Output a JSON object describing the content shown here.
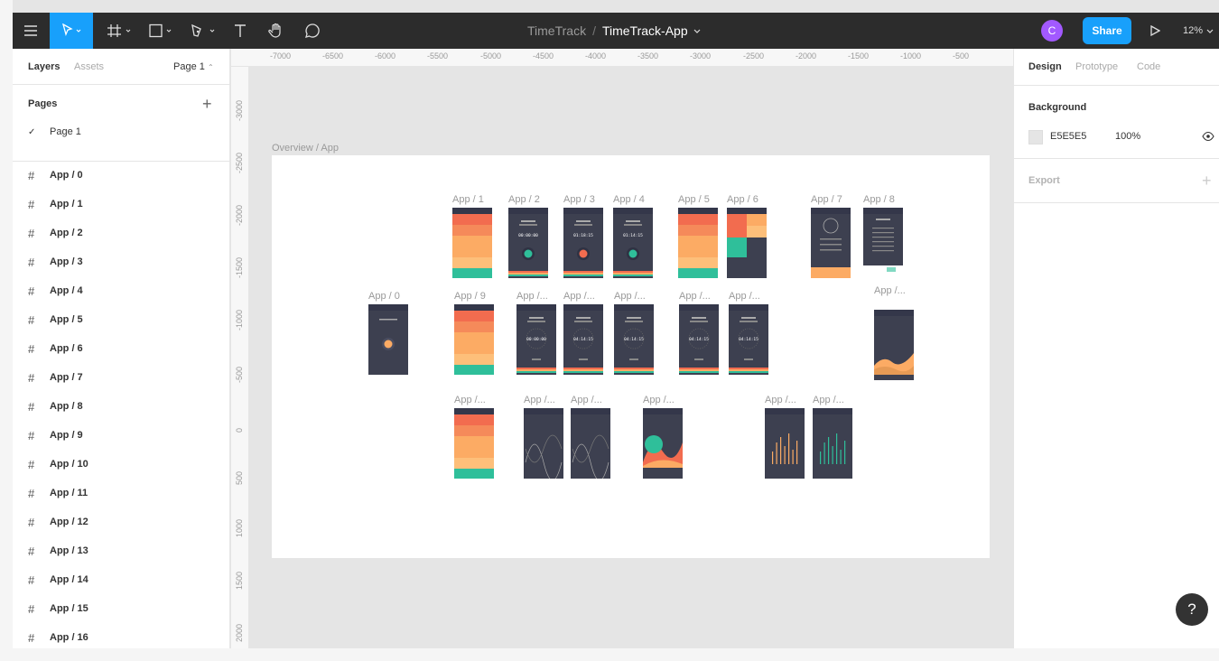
{
  "toolbar": {
    "project": "TimeTrack",
    "separator": "/",
    "file": "TimeTrack-App",
    "avatar_initial": "C",
    "share_label": "Share",
    "zoom": "12%",
    "tools": [
      "menu-icon",
      "move-icon",
      "frame-icon",
      "rectangle-icon",
      "pen-icon",
      "text-icon",
      "hand-icon",
      "comment-icon",
      "present-icon"
    ]
  },
  "left_panel": {
    "tab_layers": "Layers",
    "tab_assets": "Assets",
    "page_selector": "Page 1",
    "pages_title": "Pages",
    "pages": [
      {
        "label": "Page 1",
        "selected": true
      }
    ],
    "layers": [
      "App / 0",
      "App / 1",
      "App / 2",
      "App / 3",
      "App / 4",
      "App / 5",
      "App / 6",
      "App / 7",
      "App / 8",
      "App / 9",
      "App / 10",
      "App / 11",
      "App / 12",
      "App / 13",
      "App / 14",
      "App / 15",
      "App / 16"
    ]
  },
  "rulers": {
    "top": [
      "-7000",
      "-6500",
      "-6000",
      "-5500",
      "-5000",
      "-4500",
      "-4000",
      "-3500",
      "-3000",
      "-2500",
      "-2000",
      "-1500",
      "-1000",
      "-500"
    ],
    "left": [
      "-3000",
      "-2500",
      "-2000",
      "-1500",
      "-1000",
      "-500",
      "0",
      "500",
      "1000",
      "1500",
      "2000"
    ]
  },
  "canvas": {
    "frame_label": "Overview / App",
    "thumbnails": [
      {
        "label": "App / 1",
        "kind": "list"
      },
      {
        "label": "App / 2",
        "kind": "timer",
        "time": "00:00:00",
        "dot": "#2fbf9a"
      },
      {
        "label": "App / 3",
        "kind": "timer",
        "time": "01:18:15",
        "dot": "#f26c4f"
      },
      {
        "label": "App / 4",
        "kind": "timer",
        "time": "01:14:15",
        "dot": "#2fbf9a"
      },
      {
        "label": "App / 5",
        "kind": "list"
      },
      {
        "label": "App / 6",
        "kind": "grid"
      },
      {
        "label": "App / 7",
        "kind": "profile"
      },
      {
        "label": "App / 8",
        "kind": "settings"
      },
      {
        "label": "App / 0",
        "kind": "splash"
      },
      {
        "label": "App / 9",
        "kind": "list"
      },
      {
        "label": "App /...",
        "kind": "ring",
        "time": "00:00:00"
      },
      {
        "label": "App /...",
        "kind": "ring",
        "time": "04:14:15"
      },
      {
        "label": "App /...",
        "kind": "ring",
        "time": "04:14:15"
      },
      {
        "label": "App /...",
        "kind": "ring",
        "time": "04:14:15"
      },
      {
        "label": "App /...",
        "kind": "ring",
        "time": "04:14:15"
      },
      {
        "label": "App /...",
        "kind": "area"
      },
      {
        "label": "App /...",
        "kind": "list"
      },
      {
        "label": "App /...",
        "kind": "waves"
      },
      {
        "label": "App /...",
        "kind": "waves"
      },
      {
        "label": "App /...",
        "kind": "blobs"
      },
      {
        "label": "App /...",
        "kind": "bars-yellow"
      },
      {
        "label": "App /...",
        "kind": "bars-teal"
      }
    ]
  },
  "right_panel": {
    "tab_design": "Design",
    "tab_prototype": "Prototype",
    "tab_code": "Code",
    "background_title": "Background",
    "background_hex": "E5E5E5",
    "background_opacity": "100%",
    "export_title": "Export"
  },
  "help_label": "?",
  "colors": {
    "accent": "#18a0fb",
    "avatar": "#a259ff",
    "screen": "#3d4050",
    "coral": "#f26c4f",
    "orange": "#fcab64",
    "teal": "#2fbf9a",
    "canvas": "#e5e5e5"
  }
}
